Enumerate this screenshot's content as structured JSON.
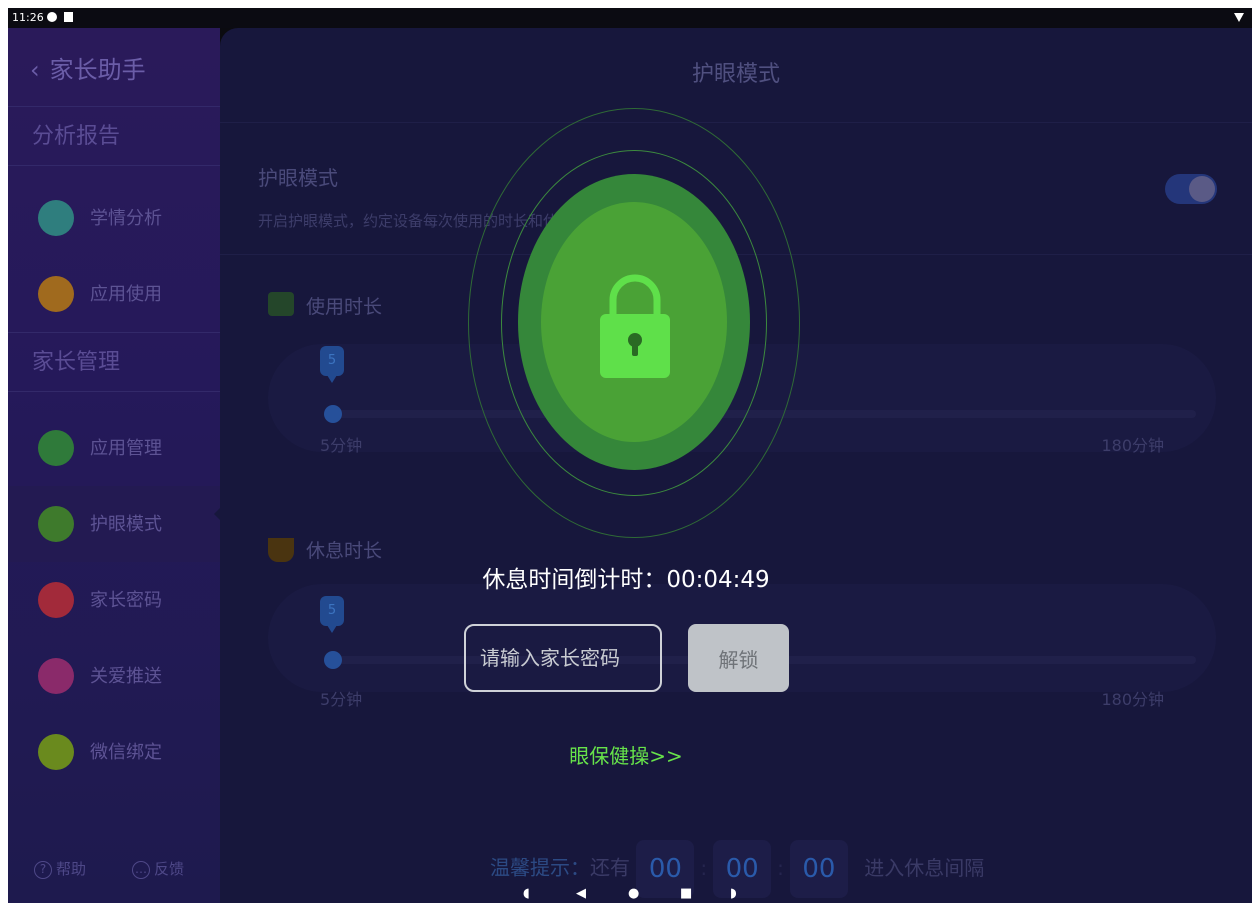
{
  "status_bar": {
    "time": "11:26"
  },
  "sidebar": {
    "back_label": "家长助手",
    "sections": [
      {
        "title": "分析报告",
        "items": [
          {
            "label": "学情分析",
            "icon": "chart-icon",
            "color": "#2f7e7e"
          },
          {
            "label": "应用使用",
            "icon": "bar-chart-icon",
            "color": "#a06a1e"
          }
        ]
      },
      {
        "title": "家长管理",
        "items": [
          {
            "label": "应用管理",
            "icon": "apps-icon",
            "color": "#2f7a3a"
          },
          {
            "label": "护眼模式",
            "icon": "eye-icon",
            "color": "#3e7a2c"
          },
          {
            "label": "家长密码",
            "icon": "lock-icon",
            "color": "#a22a3a"
          },
          {
            "label": "关爱推送",
            "icon": "send-icon",
            "color": "#8a2a6a"
          },
          {
            "label": "微信绑定",
            "icon": "link-icon",
            "color": "#6a8a1e"
          }
        ]
      }
    ],
    "footer": {
      "help": "帮助",
      "feedback": "反馈"
    }
  },
  "main": {
    "title": "护眼模式",
    "setting": {
      "title": "护眼模式",
      "desc": "开启护眼模式，约定设备每次使用的时长和休息的时长"
    },
    "usage": {
      "label": "使用时长",
      "value": "5",
      "min": "5分钟",
      "max": "180分钟",
      "fraction": 0.0
    },
    "rest": {
      "label": "休息时长",
      "value": "5",
      "min": "5分钟",
      "max": "180分钟",
      "fraction": 0.0
    },
    "tip": {
      "prefix": "温馨提示：",
      "middle": "还有",
      "h": "00",
      "m": "00",
      "s": "00",
      "suffix": "进入休息间隔"
    }
  },
  "overlay": {
    "countdown_label": "休息时间倒计时：",
    "countdown_value": "00:04:49",
    "password_placeholder": "请输入家长密码",
    "unlock_label": "解锁",
    "eye_exercise_link": "眼保健操>>"
  },
  "colors": {
    "accent_green": "#67e34a",
    "lock_green": "#5fe04a"
  }
}
